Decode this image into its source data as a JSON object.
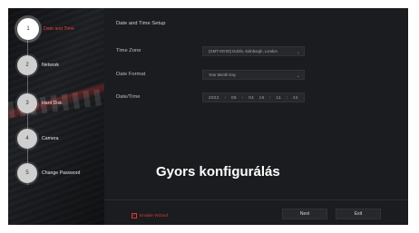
{
  "steps": [
    {
      "number": "1",
      "label": "Date and Time",
      "active": true
    },
    {
      "number": "2",
      "label": "Network",
      "active": false
    },
    {
      "number": "3",
      "label": "Hard Disk",
      "active": false
    },
    {
      "number": "4",
      "label": "Camera",
      "active": false
    },
    {
      "number": "5",
      "label": "Change Password",
      "active": false
    }
  ],
  "panel": {
    "title": "Date and Time Setup",
    "time_zone_label": "Time Zone",
    "time_zone_value": "(GMT+00:00) Dublin, Edinburgh, London",
    "date_format_label": "Date Format",
    "date_format_value": "Year Month Day",
    "datetime_label": "Date/Time",
    "datetime": {
      "year": "2022",
      "month": "06",
      "day": "04",
      "hour": "15",
      "minute": "11",
      "second": "24"
    }
  },
  "overlay_text": "Gyors konfigurálás",
  "footer": {
    "enable_wizard_label": "Enable Wizard",
    "enable_wizard_checked": true,
    "next_label": "Next",
    "exit_label": "Exit"
  },
  "colors": {
    "accent": "#d23b38",
    "background": "#1b1c1f"
  },
  "icons": {
    "dropdown": "chevron-down-icon",
    "checkbox": "check-icon"
  }
}
